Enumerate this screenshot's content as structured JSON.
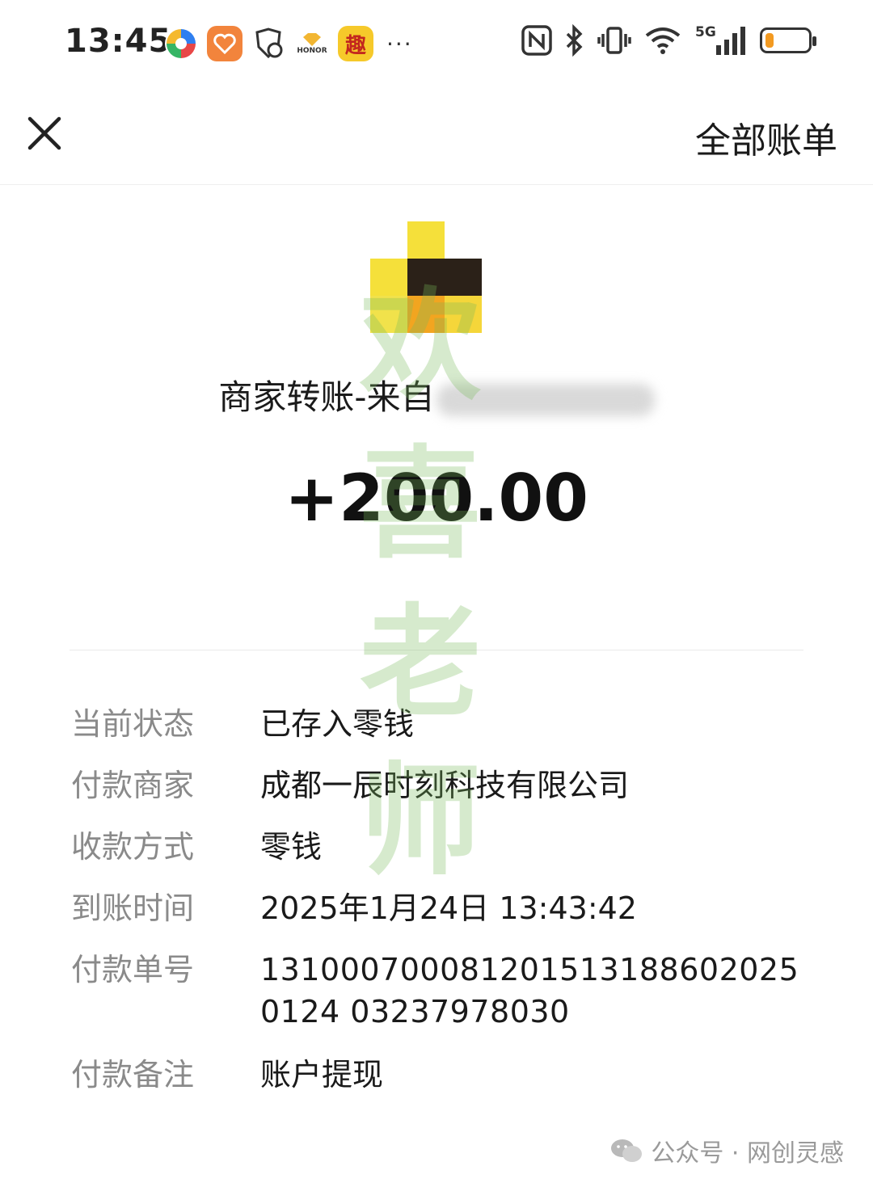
{
  "status_bar": {
    "time": "13:45",
    "network": "5G",
    "battery_level": 0.2,
    "icons": [
      "app-icon-1",
      "app-icon-2",
      "shield-icon",
      "honor-icon",
      "qu-app-icon",
      "more-dots-icon",
      "nfc-icon",
      "bluetooth-icon",
      "vibrate-icon",
      "wifi-icon",
      "signal-icon",
      "battery-icon"
    ],
    "app_icon_chars": {
      "honor": "HONOR",
      "qu": "趣"
    },
    "more": "···"
  },
  "nav": {
    "close_icon": "close-icon",
    "all_bills_label": "全部账单"
  },
  "merchant": {
    "title_prefix": "商家转账-来自",
    "amount": "+200.00",
    "logo_colors": [
      "#f5e03a",
      "#2b2118",
      "#f2a520"
    ]
  },
  "details": {
    "status_label": "当前状态",
    "status_value": "已存入零钱",
    "payer_label": "付款商家",
    "payer_value": "成都一辰时刻科技有限公司",
    "method_label": "收款方式",
    "method_value": "零钱",
    "time_label": "到账时间",
    "time_value": "2025年1月24日 13:43:42",
    "order_label": "付款单号",
    "order_value": "1310007000812015131886020250124 03237978030",
    "note_label": "付款备注",
    "note_value": "账户提现"
  },
  "watermark": {
    "chars": [
      "欢",
      "喜",
      "老",
      "师"
    ]
  },
  "footer": {
    "text": "公众号 · 网创灵感"
  }
}
